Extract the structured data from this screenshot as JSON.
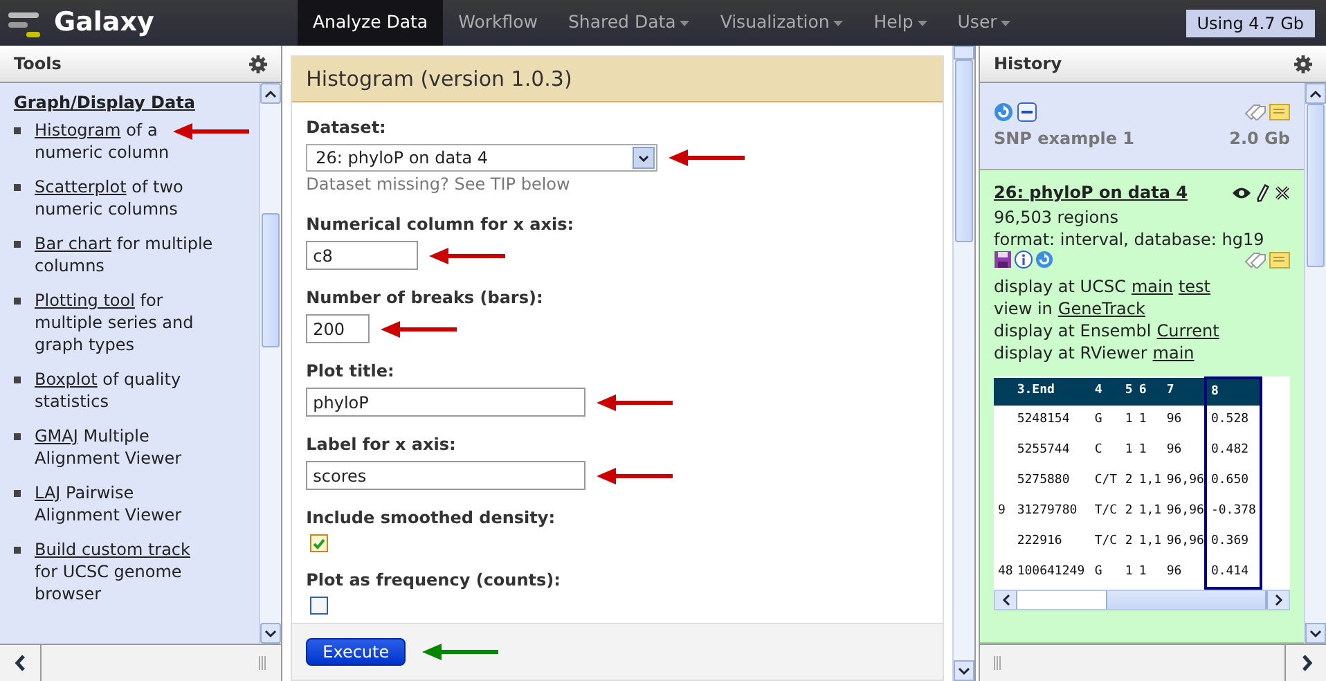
{
  "brand": {
    "name": "Galaxy"
  },
  "nav": [
    {
      "label": "Analyze Data",
      "selected": true,
      "dropdown": false
    },
    {
      "label": "Workflow",
      "selected": false,
      "dropdown": false
    },
    {
      "label": "Shared Data",
      "selected": false,
      "dropdown": true
    },
    {
      "label": "Visualization",
      "selected": false,
      "dropdown": true
    },
    {
      "label": "Help",
      "selected": false,
      "dropdown": true
    },
    {
      "label": "User",
      "selected": false,
      "dropdown": true
    }
  ],
  "usage": "Using 4.7 Gb",
  "tools": {
    "title": "Tools",
    "section": "Graph/Display Data",
    "items": [
      {
        "link": "Histogram",
        "text": "of a numeric column",
        "arrow": true
      },
      {
        "link": "Scatterplot",
        "text": "of two numeric columns"
      },
      {
        "link": "Bar chart",
        "text": "for multiple columns"
      },
      {
        "link": "Plotting tool",
        "text": "for multiple series and graph types"
      },
      {
        "link": "Boxplot",
        "text": "of quality statistics"
      },
      {
        "link": "GMAJ",
        "text": "Multiple Alignment Viewer"
      },
      {
        "link": "LAJ",
        "text": "Pairwise Alignment Viewer"
      },
      {
        "link": "Build custom track",
        "text": "for UCSC genome browser"
      }
    ]
  },
  "form": {
    "title": "Histogram (version 1.0.3)",
    "fields": [
      {
        "kind": "select",
        "label": "Dataset:",
        "value": "26: phyloP on data 4",
        "help": "Dataset missing? See TIP below",
        "arrow": true
      },
      {
        "kind": "text",
        "label": "Numerical column for x axis:",
        "value": "c8",
        "arrow": true
      },
      {
        "kind": "text",
        "label": "Number of breaks (bars):",
        "value": "200",
        "arrow": true
      },
      {
        "kind": "text",
        "label": "Plot title:",
        "value": "phyloP",
        "arrow": true
      },
      {
        "kind": "text",
        "label": "Label for x axis:",
        "value": "scores",
        "arrow": true
      },
      {
        "kind": "checkbox",
        "label": "Include smoothed density:",
        "checked": true
      },
      {
        "kind": "checkbox",
        "label": "Plot as frequency (counts):",
        "checked": false
      }
    ],
    "execute": "Execute",
    "execute_arrow": true
  },
  "history": {
    "title": "History",
    "name": "SNP example 1",
    "size": "2.0 Gb",
    "dataset": {
      "title": "26: phyloP on data 4",
      "info": [
        "96,503 regions",
        "format: interval, database: hg19"
      ],
      "links": [
        [
          {
            "text": "display at UCSC"
          },
          {
            "link": "main"
          },
          {
            "link": "test"
          }
        ],
        [
          {
            "text": "view in"
          },
          {
            "link": "GeneTrack"
          }
        ],
        [
          {
            "text": "display at Ensembl"
          },
          {
            "link": "Current"
          }
        ],
        [
          {
            "text": "display at RViewer"
          },
          {
            "link": "main"
          }
        ]
      ]
    },
    "table": {
      "columns": [
        {
          "highlighted": false
        },
        {
          "label": "3.End",
          "highlighted": false
        },
        {
          "label": "4",
          "highlighted": false
        },
        {
          "label": "5",
          "highlighted": false
        },
        {
          "label": "6",
          "highlighted": false
        },
        {
          "label": "7",
          "highlighted": false
        },
        {
          "label": "8",
          "highlighted": true
        }
      ],
      "rows": [
        [
          "",
          "5248154",
          "G",
          "1",
          "1",
          "96",
          "0.528"
        ],
        [
          "",
          "5255744",
          "C",
          "1",
          "1",
          "96",
          "0.482"
        ],
        [
          "",
          "5275880",
          "C/T",
          "2",
          "1,1",
          "96,96",
          "0.650"
        ],
        [
          "9",
          "31279780",
          "T/C",
          "2",
          "1,1",
          "96,96",
          "-0.378"
        ],
        [
          "",
          "222916",
          "T/C",
          "2",
          "1,1",
          "96,96",
          "0.369"
        ],
        [
          "48",
          "100641249",
          "G",
          "1",
          "1",
          "96",
          "0.414"
        ]
      ]
    }
  }
}
